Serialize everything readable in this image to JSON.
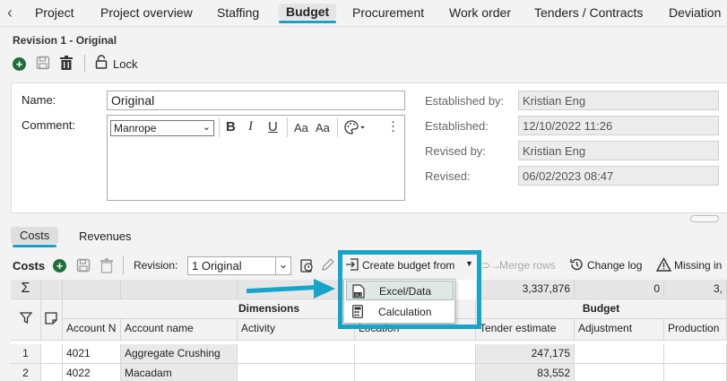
{
  "top_tabs": [
    "Project",
    "Project overview",
    "Staffing",
    "Budget",
    "Procurement",
    "Work order",
    "Tenders / Contracts",
    "Deviation"
  ],
  "revision_title": "Revision 1 - Original",
  "toolbar1": {
    "lock_label": "Lock"
  },
  "form": {
    "name_label": "Name:",
    "name_value": "Original",
    "comment_label": "Comment:",
    "font_value": "Manrope",
    "established_by_label": "Established by:",
    "established_by_value": "Kristian Eng",
    "established_label": "Established:",
    "established_value": "12/10/2022 11:26",
    "revised_by_label": "Revised by:",
    "revised_by_value": "Kristian Eng",
    "revised_label": "Revised:",
    "revised_value": "06/02/2023 08:47"
  },
  "section_tabs": {
    "costs": "Costs",
    "revenues": "Revenues"
  },
  "toolbar2": {
    "costs_label": "Costs",
    "revision_label": "Revision:",
    "revision_value": "1 Original",
    "create_budget_label": "Create budget from",
    "merge_rows_label": "Merge rows",
    "change_log_label": "Change log",
    "missing_label": "Missing in"
  },
  "dropdown": {
    "items": [
      "Excel/Data",
      "Calculation"
    ]
  },
  "grid": {
    "sum_tender": "3,337,876",
    "sum_adjustment": "0",
    "sum_production": "3,",
    "dimensions_header": "Dimensions",
    "budget_header": "Budget",
    "columns": [
      "Account N",
      "Account name",
      "Activity",
      "Location",
      "Tender estimate",
      "Adjustment",
      "Production"
    ],
    "rows": [
      {
        "num": "1",
        "account": "4021",
        "name": "Aggregate Crushing",
        "tender": "247,175"
      },
      {
        "num": "2",
        "account": "4022",
        "name": "Macadam",
        "tender": "83,552"
      }
    ]
  },
  "colors": {
    "accent": "#14a5c9",
    "add_green": "#1e6e3a"
  }
}
